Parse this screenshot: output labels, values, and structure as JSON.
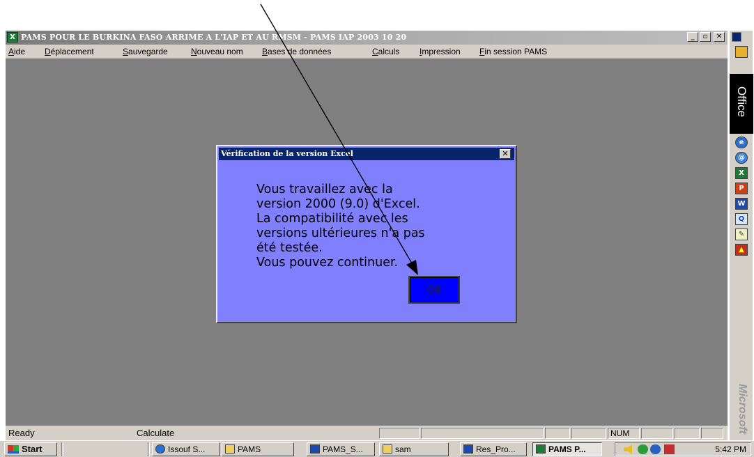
{
  "window": {
    "title": "PAMS POUR LE BURKINA FASO ARRIME A L'IAP ET AU RMSM - PAMS IAP 2003 10 20",
    "app_icon": "excel-icon",
    "controls": {
      "minimize": "_",
      "restore": "ᴮ",
      "close": "✕"
    }
  },
  "menu": {
    "items": [
      {
        "u": "A",
        "rest": "ide"
      },
      {
        "u": "D",
        "rest": "éplacement"
      },
      {
        "u": "S",
        "rest": "auvegarde"
      },
      {
        "u": "N",
        "rest": "ouveau nom"
      },
      {
        "u": "B",
        "rest": "ases de données"
      },
      {
        "u": "C",
        "rest": "alculs"
      },
      {
        "u": "I",
        "rest": "mpression"
      },
      {
        "u": "F",
        "rest": "in session PAMS"
      }
    ]
  },
  "dialog": {
    "title": "Vérification de la version Excel",
    "close": "✕",
    "lines": [
      "Vous travaillez avec la",
      "version 2000 (9.0) d'Excel.",
      "La compatibilité avec les",
      "versions ultérieures n'a pas",
      "été testée.",
      "Vous pouvez continuer."
    ],
    "ok_label": "OK"
  },
  "status": {
    "left": "Ready",
    "mode": "Calculate",
    "num": "NUM"
  },
  "office_bar": {
    "label": "Office",
    "brand": "Microsoft",
    "icons": [
      "internet-explorer-icon",
      "outlook-express-icon",
      "excel-icon",
      "powerpoint-icon",
      "word-icon",
      "find-icon",
      "note-icon",
      "briefcase-icon"
    ]
  },
  "taskbar": {
    "start": "Start",
    "tasks": [
      {
        "label": "Issouf S...",
        "icon": "ie-icon"
      },
      {
        "label": "PAMS",
        "icon": "folder-icon"
      },
      {
        "label": "PAMS_S...",
        "icon": "word-doc-icon"
      },
      {
        "label": "sam",
        "icon": "folder-icon"
      },
      {
        "label": "Res_Pro...",
        "icon": "word-doc-icon"
      },
      {
        "label": "PAMS P...",
        "icon": "excel-icon"
      }
    ],
    "clock": "5:42 PM"
  },
  "colors": {
    "workspace": "#808080",
    "dialog_bg": "#8080ff",
    "ok_button": "#0000ff",
    "titlebar_active": "#0a246a"
  }
}
